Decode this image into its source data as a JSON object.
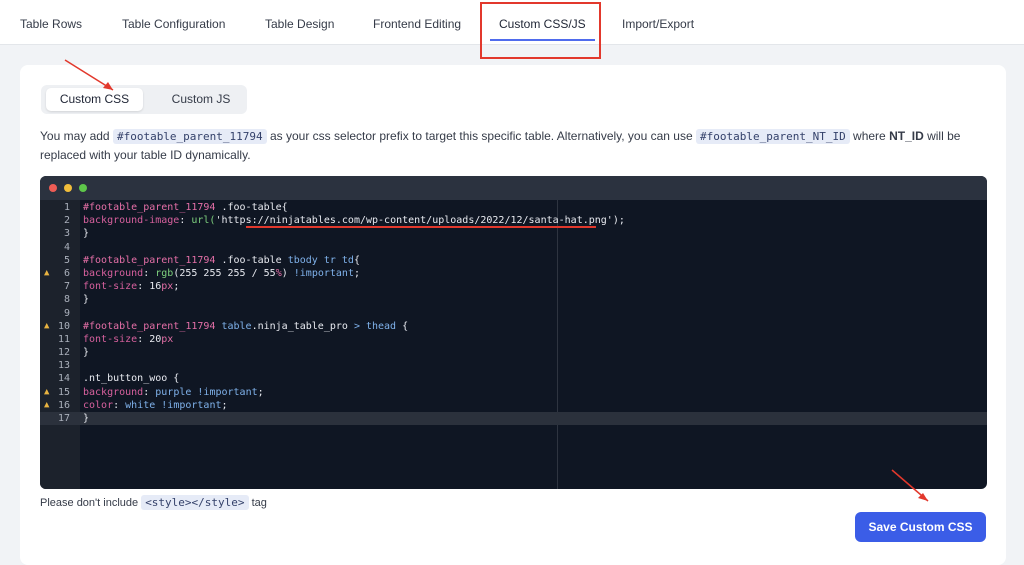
{
  "tabs": [
    "Table Rows",
    "Table Configuration",
    "Table Design",
    "Frontend Editing",
    "Custom CSS/JS",
    "Import/Export"
  ],
  "segment": {
    "css": "Custom CSS",
    "js": "Custom JS"
  },
  "desc": {
    "p1": "You may add",
    "sel1": "#footable_parent_11794",
    "p2": "as your css selector prefix to target this specific table. Alternatively, you can use",
    "sel2": "#footable_parent_NT_ID",
    "p3": "where",
    "bold": "NT_ID",
    "p4": "will be replaced with your table ID dynamically."
  },
  "code": [
    {
      "n": "1",
      "t": [
        [
          "sel",
          "#footable_parent_11794"
        ],
        [
          "txt",
          " .foo-table{"
        ]
      ]
    },
    {
      "n": "2",
      "t": [
        [
          "prop",
          "background-image"
        ],
        [
          "txt",
          ": "
        ],
        [
          "fn",
          "url("
        ],
        [
          "str",
          "'https://ninjatables.com/wp-content/uploads/2022/12/santa-hat.png'"
        ],
        [
          "txt",
          ");"
        ]
      ]
    },
    {
      "n": "3",
      "t": [
        [
          "txt",
          "}"
        ]
      ]
    },
    {
      "n": "4",
      "t": []
    },
    {
      "n": "5",
      "t": [
        [
          "sel",
          "#footable_parent_11794"
        ],
        [
          "txt",
          " .foo-table "
        ],
        [
          "kw",
          "tbody tr td"
        ],
        [
          "txt",
          "{"
        ]
      ]
    },
    {
      "n": "6",
      "w": true,
      "t": [
        [
          "prop",
          "background"
        ],
        [
          "txt",
          ": "
        ],
        [
          "fn",
          "rgb"
        ],
        [
          "txt",
          "(255 255 255 / 55"
        ],
        [
          "unit",
          "%"
        ],
        [
          "txt",
          ") "
        ],
        [
          "kw",
          "!important"
        ],
        [
          "txt",
          ";"
        ]
      ]
    },
    {
      "n": "7",
      "t": [
        [
          "prop",
          "font-size"
        ],
        [
          "txt",
          ": 16"
        ],
        [
          "unit",
          "px"
        ],
        [
          "txt",
          ";"
        ]
      ]
    },
    {
      "n": "8",
      "t": [
        [
          "txt",
          "}"
        ]
      ]
    },
    {
      "n": "9",
      "t": []
    },
    {
      "n": "10",
      "w": true,
      "t": [
        [
          "sel",
          "#footable_parent_11794"
        ],
        [
          "kw",
          " table"
        ],
        [
          "txt",
          ".ninja_table_pro "
        ],
        [
          "kw",
          "> thead"
        ],
        [
          "txt",
          " {"
        ]
      ]
    },
    {
      "n": "11",
      "t": [
        [
          "prop",
          "font-size"
        ],
        [
          "txt",
          ": 20"
        ],
        [
          "unit",
          "px"
        ]
      ]
    },
    {
      "n": "12",
      "t": [
        [
          "txt",
          "}"
        ]
      ]
    },
    {
      "n": "13",
      "t": []
    },
    {
      "n": "14",
      "t": [
        [
          "txt",
          ".nt_button_woo {"
        ]
      ]
    },
    {
      "n": "15",
      "w": true,
      "t": [
        [
          "prop",
          "background"
        ],
        [
          "txt",
          ": "
        ],
        [
          "kw",
          "purple !important"
        ],
        [
          "txt",
          ";"
        ]
      ]
    },
    {
      "n": "16",
      "w": true,
      "t": [
        [
          "prop",
          "color"
        ],
        [
          "txt",
          ": "
        ],
        [
          "kw",
          "white !important"
        ],
        [
          "txt",
          ";"
        ]
      ]
    },
    {
      "n": "17",
      "hl": true,
      "t": [
        [
          "txt",
          "}"
        ]
      ]
    }
  ],
  "footer": {
    "pre": "Please don't include",
    "tag": "<style></style>",
    "post": "tag"
  },
  "save_label": "Save Custom CSS",
  "colors": {
    "accent": "#3b5de7",
    "annotation": "#e2382c"
  }
}
